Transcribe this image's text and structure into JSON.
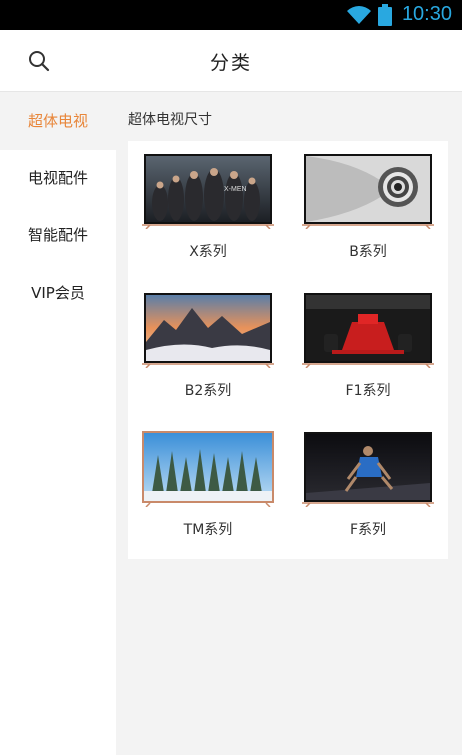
{
  "status_bar": {
    "time": "10:30",
    "wifi_icon": "wifi-icon",
    "battery_icon": "battery-icon"
  },
  "header": {
    "title": "分类",
    "search_icon": "search-icon"
  },
  "sidebar": {
    "items": [
      {
        "label": "超体电视",
        "active": true
      },
      {
        "label": "电视配件",
        "active": false
      },
      {
        "label": "智能配件",
        "active": false
      },
      {
        "label": "VIP会员",
        "active": false
      }
    ]
  },
  "main": {
    "section_title": "超体电视尺寸",
    "products": [
      {
        "label": "X系列",
        "image": "xmen-movie-poster"
      },
      {
        "label": "B系列",
        "image": "spiral-staircase"
      },
      {
        "label": "B2系列",
        "image": "mountain-sunset"
      },
      {
        "label": "F1系列",
        "image": "f1-race-car"
      },
      {
        "label": "TM系列",
        "image": "snowy-forest"
      },
      {
        "label": "F系列",
        "image": "sprinter-start"
      }
    ]
  },
  "colors": {
    "accent": "#e8863a",
    "status_icon": "#29a8e0",
    "tv_frame": "#c98a6a"
  }
}
